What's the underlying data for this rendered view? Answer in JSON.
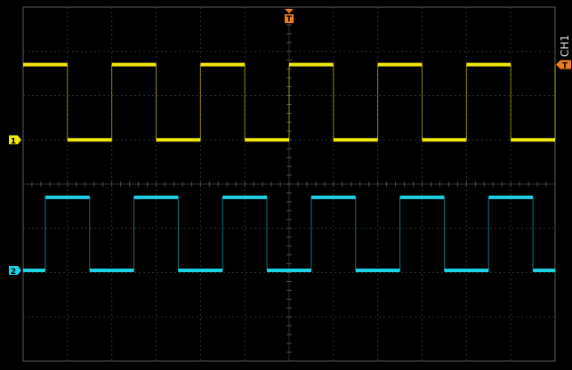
{
  "scope": {
    "channel_label": "CH1",
    "trigger_marker": "T",
    "colors": {
      "background": "#000000",
      "grid": "#2e2e2e",
      "border": "#5a5a5a",
      "ch1": "#f0e80a",
      "ch2": "#1ed2e6",
      "trigger": "#f07c14"
    }
  },
  "chart_data": {
    "type": "line",
    "grid": true,
    "divisions": {
      "horizontal": 12,
      "vertical": 8
    },
    "x_range_div": [
      0,
      12
    ],
    "y_range_div": [
      -4,
      4
    ],
    "trigger": {
      "time_div": 6,
      "level_div": 2.7
    },
    "series": [
      {
        "name": "1",
        "color": "#f0e80a",
        "ground_div": 1.0,
        "low_div": 1.0,
        "high_div": 2.7,
        "period_div": 2.0,
        "rising_edges_div": [
          2.0,
          4.0,
          6.0,
          8.0,
          10.0,
          12.0
        ],
        "falling_edges_div": [
          1.0,
          3.0,
          5.0,
          7.0,
          9.0,
          11.0
        ],
        "start_level": "high"
      },
      {
        "name": "2",
        "color": "#1ed2e6",
        "ground_div": -1.95,
        "low_div": -1.95,
        "high_div": -0.3,
        "period_div": 2.0,
        "rising_edges_div": [
          0.5,
          2.5,
          4.5,
          6.5,
          8.5,
          10.5
        ],
        "falling_edges_div": [
          1.5,
          3.5,
          5.5,
          7.5,
          9.5,
          11.5
        ],
        "start_level": "low"
      }
    ]
  }
}
